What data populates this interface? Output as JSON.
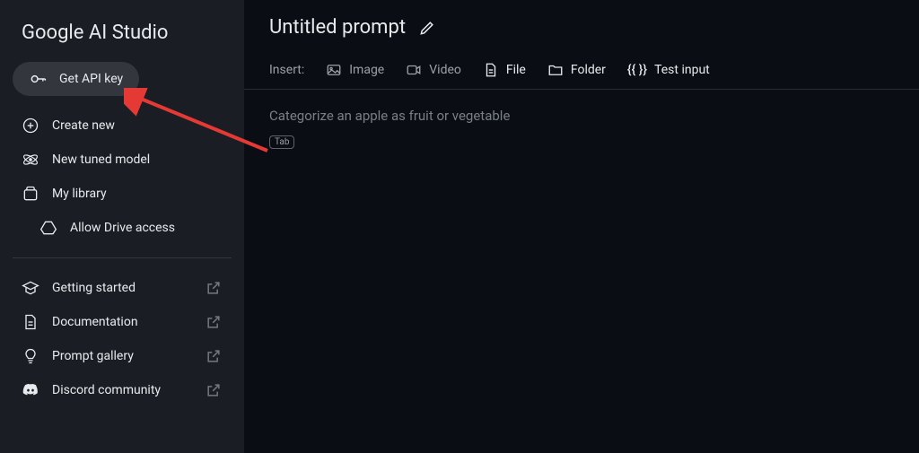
{
  "app": {
    "name": "Google AI Studio"
  },
  "sidebar": {
    "api_key_label": "Get API key",
    "items1": [
      {
        "label": "Create new"
      },
      {
        "label": "New tuned model"
      },
      {
        "label": "My library"
      },
      {
        "label": "Allow Drive access"
      }
    ],
    "items2": [
      {
        "label": "Getting started"
      },
      {
        "label": "Documentation"
      },
      {
        "label": "Prompt gallery"
      },
      {
        "label": "Discord community"
      }
    ]
  },
  "header": {
    "title": "Untitled prompt"
  },
  "toolbar": {
    "insert_label": "Insert:",
    "image": "Image",
    "video": "Video",
    "file": "File",
    "folder": "Folder",
    "test_input_prefix": "{{ }}",
    "test_input": "Test input"
  },
  "prompt": {
    "placeholder": "Categorize an apple as fruit or vegetable",
    "tab_hint": "Tab"
  }
}
